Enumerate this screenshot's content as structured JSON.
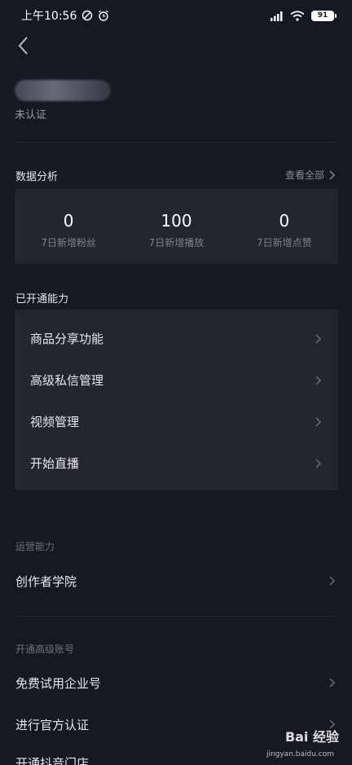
{
  "status": {
    "time": "上午10:56",
    "battery": "91"
  },
  "profile": {
    "verify_status": "未认证"
  },
  "data_analysis": {
    "title": "数据分析",
    "see_all": "查看全部",
    "stats": [
      {
        "value": "0",
        "label": "7日新增粉丝"
      },
      {
        "value": "100",
        "label": "7日新增播放"
      },
      {
        "value": "0",
        "label": "7日新增点赞"
      }
    ]
  },
  "capabilities": {
    "title": "已开通能力",
    "items": [
      "商品分享功能",
      "高级私信管理",
      "视频管理",
      "开始直播"
    ]
  },
  "operations": {
    "title": "运营能力",
    "items": [
      "创作者学院"
    ]
  },
  "upgrade": {
    "title": "开通高级账号",
    "items": [
      "免费试用企业号",
      "进行官方认证",
      "开通抖音门店"
    ]
  },
  "watermark": {
    "main": "Bai 经验",
    "sub": "jingyan.baidu.com"
  }
}
